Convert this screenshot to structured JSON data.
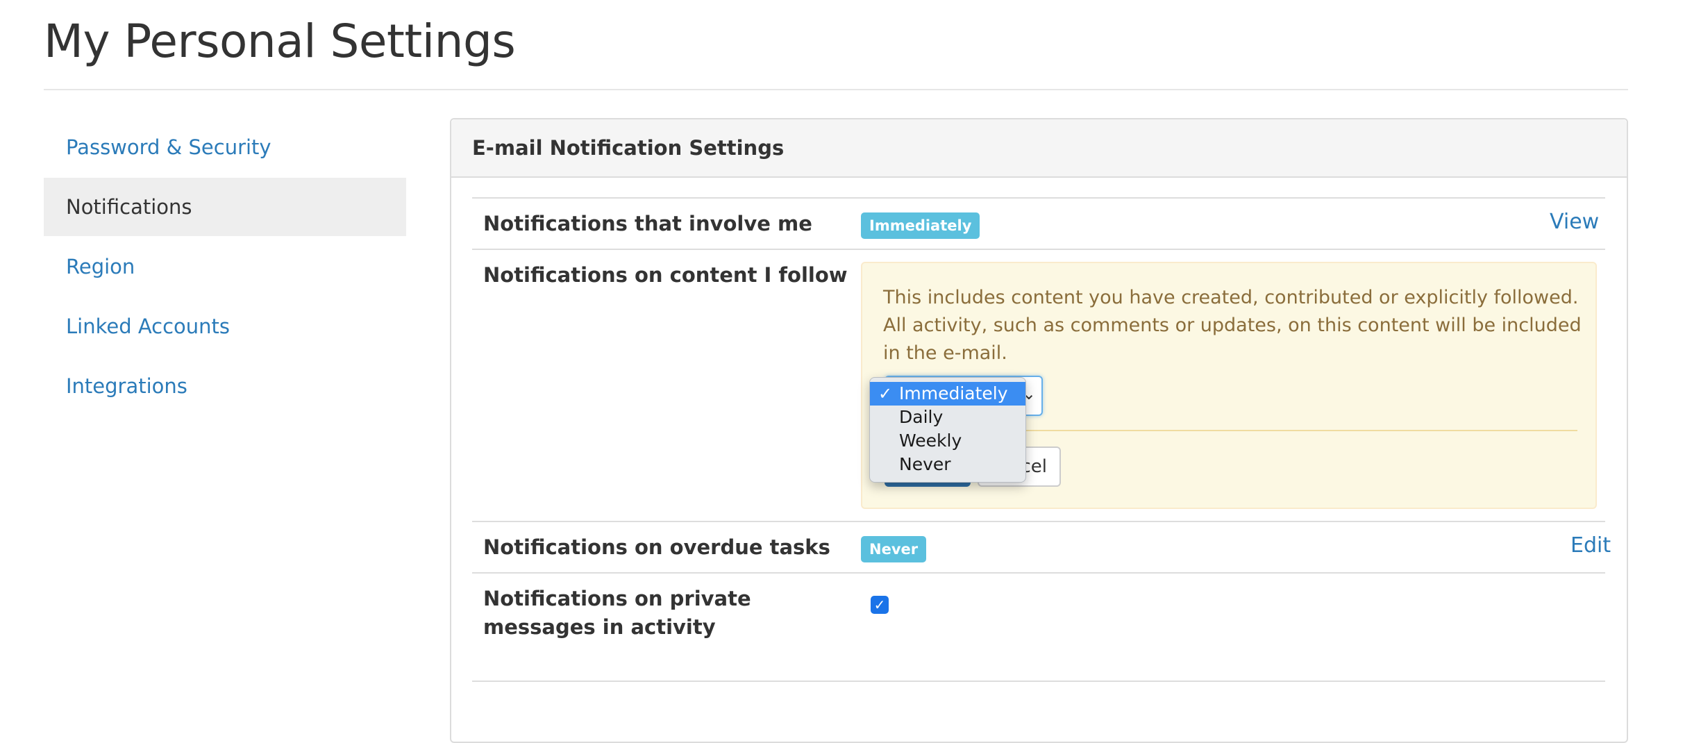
{
  "page": {
    "title": "My Personal Settings"
  },
  "sidebar": {
    "items": [
      {
        "label": "Password & Security"
      },
      {
        "label": "Notifications"
      },
      {
        "label": "Region"
      },
      {
        "label": "Linked Accounts"
      },
      {
        "label": "Integrations"
      }
    ],
    "active_index": 1
  },
  "panel": {
    "title": "E-mail Notification Settings",
    "rows": [
      {
        "label": "Notifications that involve me",
        "badge": "Immediately",
        "action": "View"
      },
      {
        "label": "Notifications on content I follow",
        "info": "This includes content you have created, contributed or explicitly followed. All activity, such as comments or updates, on this content will be included in the e-mail.",
        "cancel_label": "ncel",
        "dropdown": {
          "selected": "Immediately",
          "options": [
            "Immediately",
            "Daily",
            "Weekly",
            "Never"
          ]
        }
      },
      {
        "label": "Notifications on overdue tasks",
        "badge": "Never",
        "action": "Edit"
      },
      {
        "label": "Notifications on private messages in activity",
        "checked": true
      }
    ]
  },
  "colors": {
    "link": "#2b7bb9",
    "badge": "#5bc0de",
    "warning_bg": "#fcf8e3",
    "warning_text": "#8a6d3b",
    "primary_button": "#2e6da4",
    "menu_highlight": "#3b8df2"
  }
}
